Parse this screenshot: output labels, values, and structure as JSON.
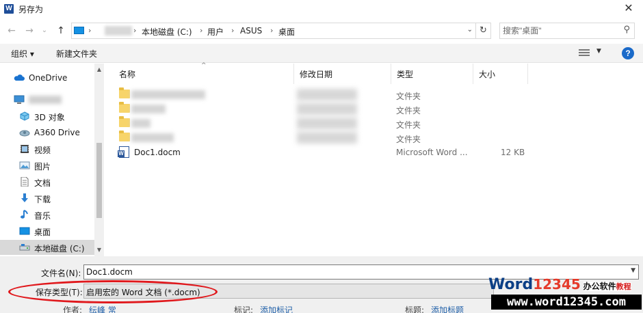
{
  "window": {
    "title": "另存为",
    "close": "✕",
    "app_icon": "W"
  },
  "nav": {
    "back": "←",
    "forward": "→",
    "recent": "⌄",
    "up": "↑"
  },
  "address": {
    "crumbs": [
      {
        "label": "本地磁盘 (C:)"
      },
      {
        "label": "用户"
      },
      {
        "label": "ASUS"
      },
      {
        "label": "桌面"
      }
    ],
    "separator": "›",
    "refresh": "↻",
    "dropdown": "⌄"
  },
  "search": {
    "placeholder": "搜索\"桌面\"",
    "icon": "⚲"
  },
  "toolbar": {
    "organize": "组织 ▾",
    "new_folder": "新建文件夹",
    "help": "?",
    "view_dropdown": "▼"
  },
  "sidebar": {
    "items": [
      {
        "label": "OneDrive",
        "icon": "cloud-icon"
      },
      {
        "label": "",
        "icon": "computer-icon"
      },
      {
        "label": "3D 对象",
        "icon": "cube-icon"
      },
      {
        "label": "A360 Drive",
        "icon": "drive-icon"
      },
      {
        "label": "视频",
        "icon": "video-icon"
      },
      {
        "label": "图片",
        "icon": "picture-icon"
      },
      {
        "label": "文档",
        "icon": "document-icon"
      },
      {
        "label": "下载",
        "icon": "download-icon"
      },
      {
        "label": "音乐",
        "icon": "music-icon"
      },
      {
        "label": "桌面",
        "icon": "desktop-icon"
      },
      {
        "label": "本地磁盘 (C:)",
        "icon": "disk-icon"
      }
    ],
    "scroll_up": "▲",
    "scroll_down": "▼"
  },
  "columns": {
    "name": "名称",
    "modified": "修改日期",
    "type": "类型",
    "size": "大小",
    "sort": "^"
  },
  "files": [
    {
      "type": "文件夹"
    },
    {
      "type": "文件夹"
    },
    {
      "type": "文件夹"
    },
    {
      "type": "文件夹"
    },
    {
      "name": "Doc1.docm",
      "type": "Microsoft Word ...",
      "size": "12 KB"
    }
  ],
  "save": {
    "filename_label": "文件名(N):",
    "filename_value": "Doc1.docm",
    "type_label": "保存类型(T):",
    "type_value": "启用宏的 Word 文档 (*.docm)",
    "author_label": "作者:",
    "author_value": "纭峰 常",
    "tags_label": "标记:",
    "tags_value": "添加标记",
    "title_label": "标题:",
    "title_value": "添加标题"
  },
  "watermark": {
    "word": "Word",
    "digits": "12345",
    "cn": "办公软件",
    "cn2": "教程",
    "url": "www.word12345.com"
  },
  "colors": {
    "accent": "#1b6ac9",
    "highlight": "#e0181c",
    "selection": "#d9d9d9"
  }
}
